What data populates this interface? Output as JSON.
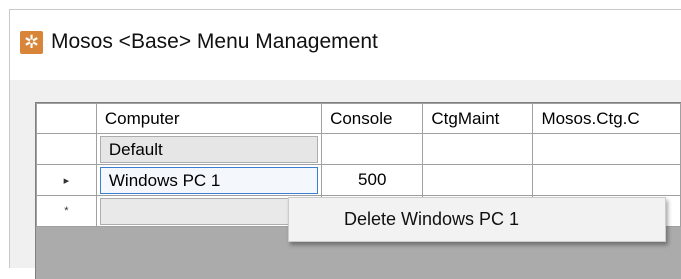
{
  "window": {
    "title": "Mosos <Base> Menu Management",
    "icon": "gear-icon",
    "accent": "#d8853a"
  },
  "grid": {
    "columns": [
      "Computer",
      "Console",
      "CtgMaint",
      "Mosos.Ctg.C"
    ],
    "rows": [
      {
        "marker": "",
        "computer": "Default",
        "console": ""
      },
      {
        "marker": "▸",
        "computer": "Windows PC 1",
        "console": "500"
      },
      {
        "marker": "*",
        "computer": "",
        "console": ""
      }
    ]
  },
  "context_menu": {
    "items": [
      "Delete Windows PC 1"
    ]
  }
}
